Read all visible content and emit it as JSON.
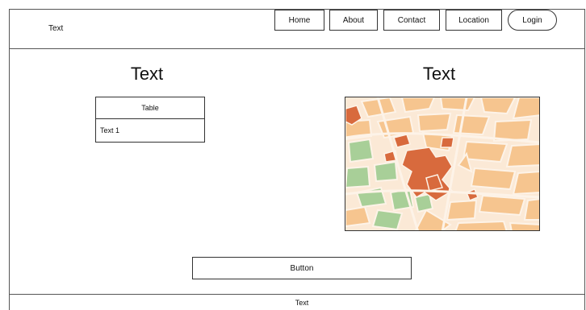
{
  "header": {
    "logo_text": "Text",
    "nav": {
      "home": "Home",
      "about": "About",
      "contact": "Contact",
      "location": "Location",
      "login": "Login"
    }
  },
  "main": {
    "left_heading": "Text",
    "right_heading": "Text",
    "table": {
      "header": "Table",
      "rows": [
        "Text 1"
      ]
    },
    "map": {
      "icon": "map-image",
      "colors": {
        "block": "#f7c58f",
        "park": "#9fcb93",
        "landmark": "#d9663a",
        "street": "#fdf3e8"
      }
    },
    "button_label": "Button"
  },
  "footer": {
    "text": "Text"
  }
}
